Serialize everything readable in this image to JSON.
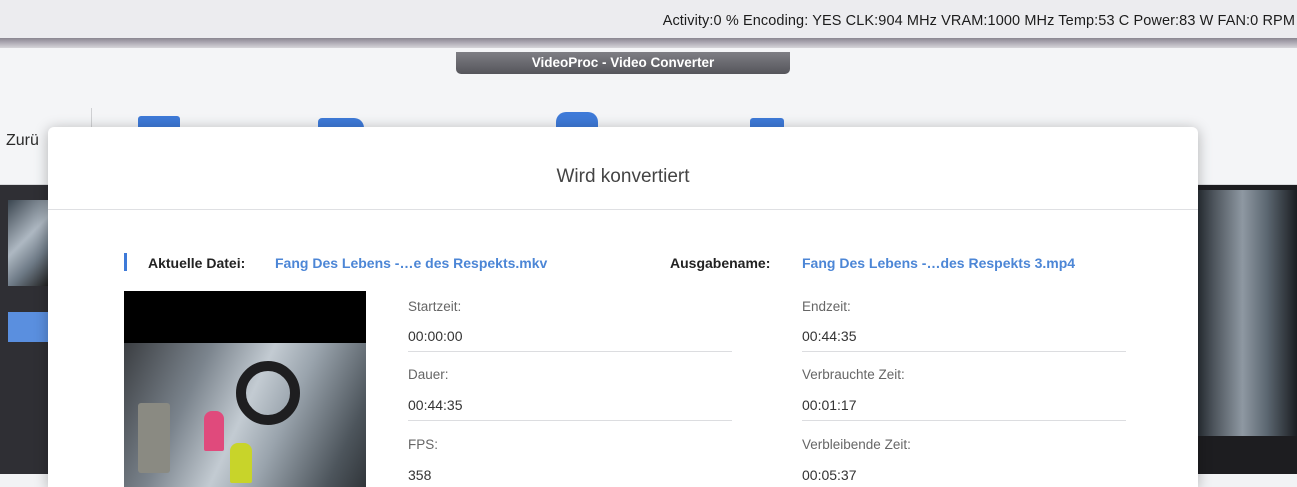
{
  "menubar": {
    "gpu_status": "Activity:0 %  Encoding: YES   CLK:904 MHz  VRAM:1000 MHz  Temp:53 C  Power:83 W  FAN:0 RPM"
  },
  "window": {
    "title": "VideoProc - Video Converter"
  },
  "toolbar": {
    "back_label": "Zurü",
    "icons": [
      "video-icon",
      "folder-icon",
      "music-icon",
      "clipboard-icon"
    ]
  },
  "dialog": {
    "title": "Wird konvertiert",
    "current_file_label": "Aktuelle Datei:",
    "current_file_value": "Fang Des Lebens -…e des Respekts.mkv",
    "output_name_label": "Ausgabename:",
    "output_name_value": "Fang Des Lebens -…des Respekts 3.mp4",
    "fields": {
      "start_label": "Startzeit:",
      "start_value": "00:00:00",
      "end_label": "Endzeit:",
      "end_value": "00:44:35",
      "duration_label": "Dauer:",
      "duration_value": "00:44:35",
      "elapsed_label": "Verbrauchte Zeit:",
      "elapsed_value": "00:01:17",
      "fps_label": "FPS:",
      "fps_value": "358",
      "remaining_label": "Verbleibende Zeit:",
      "remaining_value": "00:05:37"
    }
  },
  "colors": {
    "accent": "#4c86d6",
    "accent_dark": "#3e7ad8"
  }
}
